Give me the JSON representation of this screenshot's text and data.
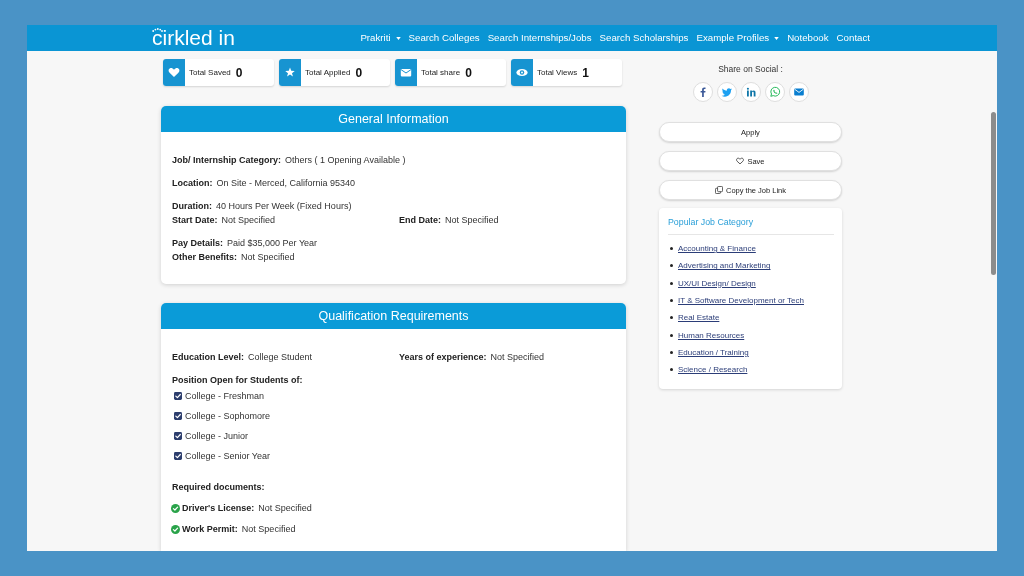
{
  "nav": {
    "logo": "cirkled in",
    "links": [
      {
        "label": "Prakriti",
        "dropdown": true
      },
      {
        "label": "Search Colleges",
        "dropdown": false
      },
      {
        "label": "Search Internships/Jobs",
        "dropdown": false
      },
      {
        "label": "Search Scholarships",
        "dropdown": false
      },
      {
        "label": "Example Profiles",
        "dropdown": true
      },
      {
        "label": "Notebook",
        "dropdown": false
      },
      {
        "label": "Contact",
        "dropdown": false
      }
    ]
  },
  "stats": [
    {
      "kind": "saved",
      "label": "Total Saved",
      "value": "0"
    },
    {
      "kind": "applied",
      "label": "Total Applied",
      "value": "0"
    },
    {
      "kind": "share",
      "label": "Total share",
      "value": "0"
    },
    {
      "kind": "views",
      "label": "Total Views",
      "value": "1"
    }
  ],
  "share": {
    "title": "Share on Social :",
    "networks": [
      {
        "kind": "facebook"
      },
      {
        "kind": "twitter"
      },
      {
        "kind": "linkedin"
      },
      {
        "kind": "whatsapp"
      },
      {
        "kind": "email"
      }
    ]
  },
  "general": {
    "title": "General Information",
    "groups": [
      {
        "rows": [
          [
            {
              "label": "Job/ Internship Category:",
              "value": "Others ( 1 Opening Available )"
            }
          ]
        ]
      },
      {
        "rows": [
          [
            {
              "label": "Location:",
              "value": "On Site - Merced, California 95340"
            }
          ]
        ]
      },
      {
        "rows": [
          [
            {
              "label": "Duration:",
              "value": "40 Hours Per Week (Fixed Hours)"
            }
          ],
          [
            {
              "label": "Start Date:",
              "value": "Not Specified"
            },
            {
              "label": "End Date:",
              "value": "Not Specified"
            }
          ]
        ]
      },
      {
        "rows": [
          [
            {
              "label": "Pay Details:",
              "value": "Paid $35,000 Per Year"
            }
          ],
          [
            {
              "label": "Other Benefits:",
              "value": "Not Specified"
            }
          ]
        ]
      }
    ]
  },
  "qualification": {
    "title": "Qualification Requirements",
    "fields": [
      {
        "label": "Education Level:",
        "value": "College Student"
      },
      {
        "label": "Years of experience:",
        "value": "Not Specified"
      }
    ],
    "students_heading": "Position Open for Students of:",
    "students": [
      {
        "label": "College - Freshman",
        "checked": true
      },
      {
        "label": "College - Sophomore",
        "checked": true
      },
      {
        "label": "College - Junior",
        "checked": true
      },
      {
        "label": "College - Senior Year",
        "checked": true
      }
    ],
    "documents_heading": "Required documents:",
    "documents": [
      {
        "label": "Driver's License:",
        "value": "Not Specified"
      },
      {
        "label": "Work Permit:",
        "value": "Not Specified"
      }
    ]
  },
  "actions": [
    {
      "kind": "apply",
      "label": "Apply"
    },
    {
      "kind": "save",
      "label": "Save"
    },
    {
      "kind": "copy",
      "label": "Copy the Job Link"
    }
  ],
  "popular": {
    "title": "Popular Job Category",
    "items": [
      "Accounting & Finance",
      "Advertising and Marketing",
      "UX/UI Design/ Design",
      "IT & Software Development or Tech",
      "Real Estate",
      "Human Resources",
      "Education / Training",
      "Science / Research"
    ]
  }
}
